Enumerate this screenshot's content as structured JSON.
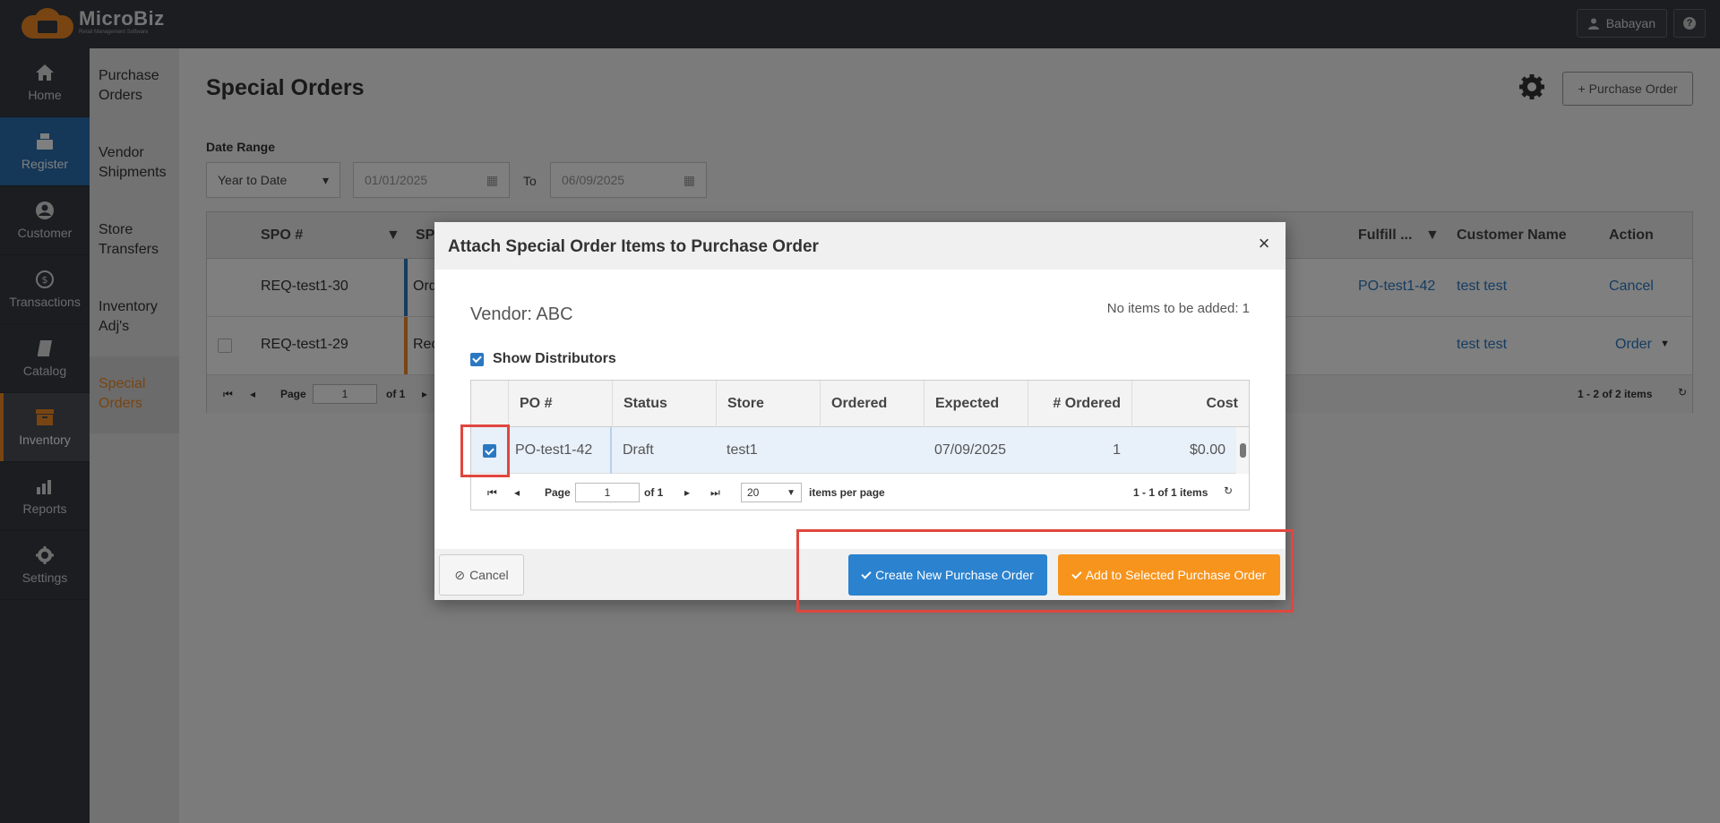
{
  "app": {
    "brand": "MicroBiz",
    "tagline": "Retail Management Software",
    "user": "Babayan",
    "help": "?"
  },
  "nav": [
    {
      "label": "Home",
      "icon": "home-icon"
    },
    {
      "label": "Register",
      "icon": "register-icon"
    },
    {
      "label": "Customer",
      "icon": "customer-icon"
    },
    {
      "label": "Transactions",
      "icon": "transactions-icon"
    },
    {
      "label": "Catalog",
      "icon": "catalog-icon"
    },
    {
      "label": "Inventory",
      "icon": "inventory-icon"
    },
    {
      "label": "Reports",
      "icon": "reports-icon"
    },
    {
      "label": "Settings",
      "icon": "settings-icon"
    }
  ],
  "subnav": [
    "Purchase Orders",
    "Vendor Shipments",
    "Store Transfers",
    "Inventory Adj's",
    "Special Orders"
  ],
  "page": {
    "title": "Special Orders",
    "new_po_label": "Purchase Order",
    "date_range_label": "Date Range",
    "date_range_value": "Year to Date",
    "from_date": "01/01/2025",
    "to_label": "To",
    "to_date": "06/09/2025"
  },
  "grid": {
    "headers": {
      "spo": "SPO #",
      "sp": "SP",
      "fulfill": "Fulfill ...",
      "customer": "Customer Name",
      "action": "Action"
    },
    "rows": [
      {
        "spo": "REQ-test1-30",
        "sp": "Ord",
        "fulfill": "PO-test1-42",
        "customer": "test test",
        "action": "Cancel"
      },
      {
        "spo": "REQ-test1-29",
        "sp": "Rec",
        "fulfill": "",
        "customer": "test test",
        "action": "Order"
      }
    ],
    "pager": {
      "page_label": "Page",
      "page": "1",
      "of": "of 1",
      "summary": "1 - 2 of 2 items"
    }
  },
  "dialog": {
    "title": "Attach Special Order Items to Purchase Order",
    "close": "×",
    "vendor": "Vendor: ABC",
    "no_items": "No items to be added: 1",
    "show_distributors": "Show Distributors",
    "headers": {
      "po": "PO #",
      "status": "Status",
      "store": "Store",
      "ordered": "Ordered",
      "expected": "Expected",
      "num_ordered": "# Ordered",
      "cost": "Cost"
    },
    "row": {
      "po": "PO-test1-42",
      "status": "Draft",
      "store": "test1",
      "ordered": "",
      "expected": "07/09/2025",
      "num_ordered": "1",
      "cost": "$0.00"
    },
    "pager": {
      "page_label": "Page",
      "page": "1",
      "of": "of 1",
      "per_page": "20",
      "per_page_label": "items per page",
      "summary": "1 - 1 of 1 items"
    },
    "cancel_label": "Cancel",
    "create_label": "Create New Purchase Order",
    "add_label": "Add to Selected Purchase Order"
  },
  "colors": {
    "accent_orange": "#f7941d",
    "accent_blue": "#2b82cf",
    "highlight": "#e0463f"
  }
}
